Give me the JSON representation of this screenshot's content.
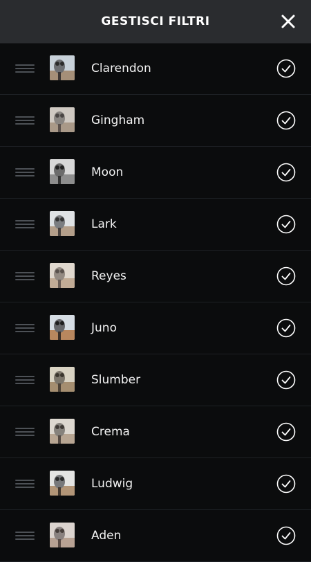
{
  "header": {
    "title": "GESTISCI FILTRI",
    "close_icon": "close-icon"
  },
  "filters": [
    {
      "name": "Clarendon",
      "enabled": true
    },
    {
      "name": "Gingham",
      "enabled": true
    },
    {
      "name": "Moon",
      "enabled": true
    },
    {
      "name": "Lark",
      "enabled": true
    },
    {
      "name": "Reyes",
      "enabled": true
    },
    {
      "name": "Juno",
      "enabled": true
    },
    {
      "name": "Slumber",
      "enabled": true
    },
    {
      "name": "Crema",
      "enabled": true
    },
    {
      "name": "Ludwig",
      "enabled": true
    },
    {
      "name": "Aden",
      "enabled": true
    }
  ],
  "colors": {
    "background": "#0b0c0d",
    "header": "#2a2c2f",
    "text": "#ffffff",
    "divider": "#1e2125"
  }
}
